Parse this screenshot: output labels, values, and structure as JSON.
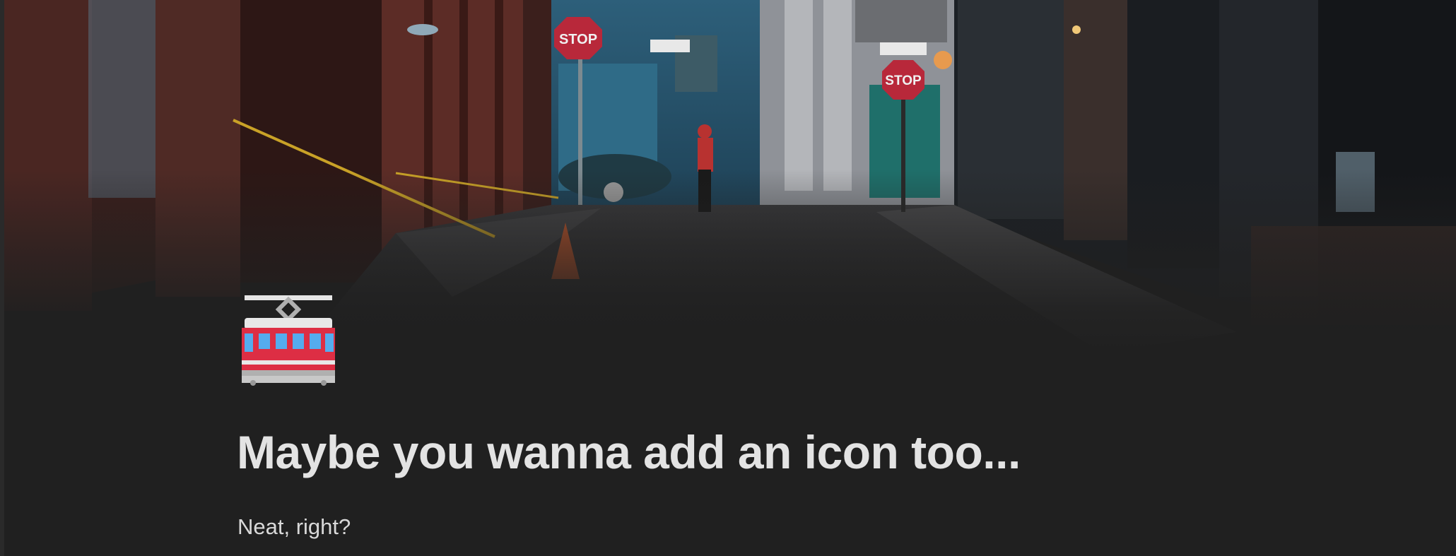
{
  "page": {
    "cover_image": "city-alley-photo",
    "icon": "tram-icon",
    "title": "Maybe you wanna add an icon too...",
    "body_text": "Neat, right?"
  },
  "cover_signs": {
    "stop_left": "STOP",
    "stop_right": "STOP"
  },
  "colors": {
    "background": "#202020",
    "title": "#e3e3e3",
    "text": "#d9d9d9",
    "tram_red": "#dd2e44",
    "tram_window": "#55acee"
  }
}
